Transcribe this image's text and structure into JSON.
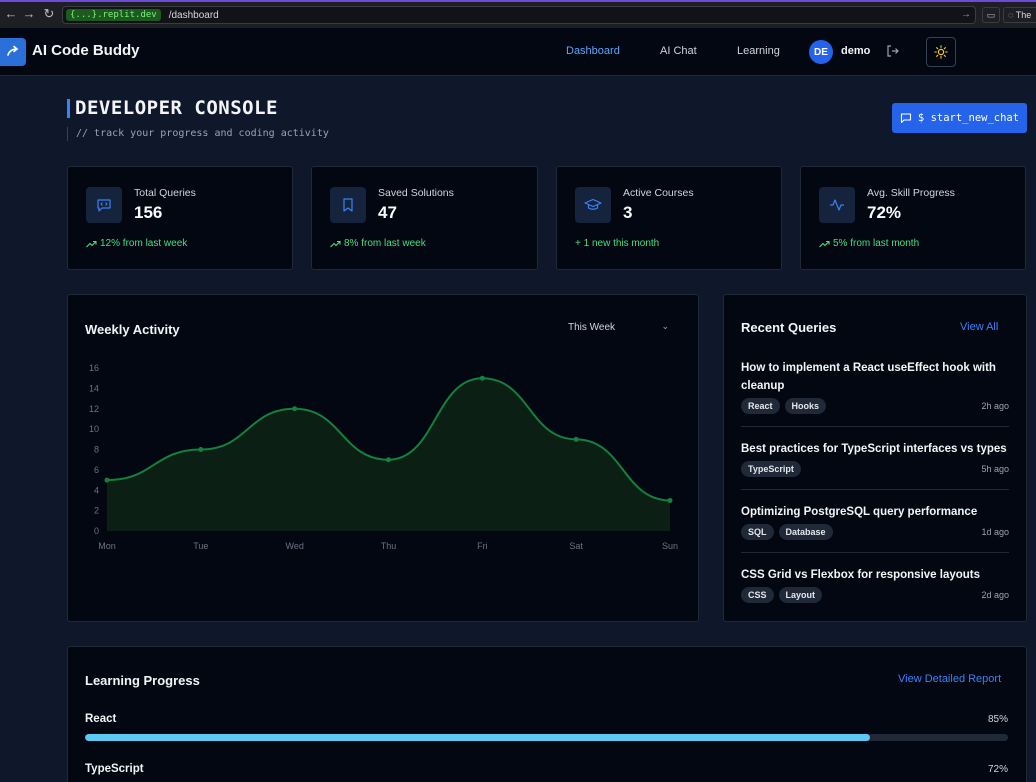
{
  "browser": {
    "url_domain": "{...}.replit.dev",
    "url_path": "/dashboard",
    "tab_text": "The"
  },
  "header": {
    "title": "AI Code Buddy",
    "nav": [
      "Dashboard",
      "AI Chat",
      "Learning"
    ],
    "active_nav": "Dashboard",
    "avatar_initials": "DE",
    "username": "demo"
  },
  "page": {
    "title": "DEVELOPER CONSOLE",
    "subtitle": "// track your progress and coding activity",
    "new_chat_label": "$ start_new_chat"
  },
  "stats": [
    {
      "label": "Total Queries",
      "value": "156",
      "change": "12% from last week",
      "icon": "code-chat-icon",
      "change_icon": "trend-up-icon"
    },
    {
      "label": "Saved Solutions",
      "value": "47",
      "change": "8% from last week",
      "icon": "bookmark-icon",
      "change_icon": "trend-up-icon"
    },
    {
      "label": "Active Courses",
      "value": "3",
      "change": "+ 1 new this month",
      "icon": "graduation-cap-icon",
      "change_icon": "none"
    },
    {
      "label": "Avg. Skill Progress",
      "value": "72%",
      "change": "5% from last month",
      "icon": "activity-icon",
      "change_icon": "trend-up-icon"
    }
  ],
  "activity": {
    "title": "Weekly Activity",
    "range_selected": "This Week"
  },
  "chart_data": {
    "type": "area",
    "categories": [
      "Mon",
      "Tue",
      "Wed",
      "Thu",
      "Fri",
      "Sat",
      "Sun"
    ],
    "values": [
      5,
      8,
      12,
      7,
      15,
      9,
      3
    ],
    "ylim": [
      0,
      16
    ],
    "yticks": [
      0,
      2,
      4,
      6,
      8,
      10,
      12,
      14,
      16
    ],
    "line_color": "#15803d",
    "fill_color": "#0c1f14",
    "grid": false,
    "title": "",
    "xlabel": "",
    "ylabel": ""
  },
  "recent": {
    "title": "Recent Queries",
    "view_all": "View All",
    "items": [
      {
        "title": "How to implement a React useEffect hook with cleanup",
        "tags": [
          "React",
          "Hooks"
        ],
        "time": "2h ago"
      },
      {
        "title": "Best practices for TypeScript interfaces vs types",
        "tags": [
          "TypeScript"
        ],
        "time": "5h ago"
      },
      {
        "title": "Optimizing PostgreSQL query performance",
        "tags": [
          "SQL",
          "Database"
        ],
        "time": "1d ago"
      },
      {
        "title": "CSS Grid vs Flexbox for responsive layouts",
        "tags": [
          "CSS",
          "Layout"
        ],
        "time": "2d ago"
      }
    ]
  },
  "learning": {
    "title": "Learning Progress",
    "report_link": "View Detailed Report",
    "items": [
      {
        "label": "React",
        "pct_text": "85%",
        "progress": 0.85
      },
      {
        "label": "TypeScript",
        "pct_text": "72%",
        "progress": 0.72
      }
    ]
  },
  "colors": {
    "accent": "#2563eb",
    "positive": "#4ade80",
    "progress_fill": "#5ec8f4"
  }
}
